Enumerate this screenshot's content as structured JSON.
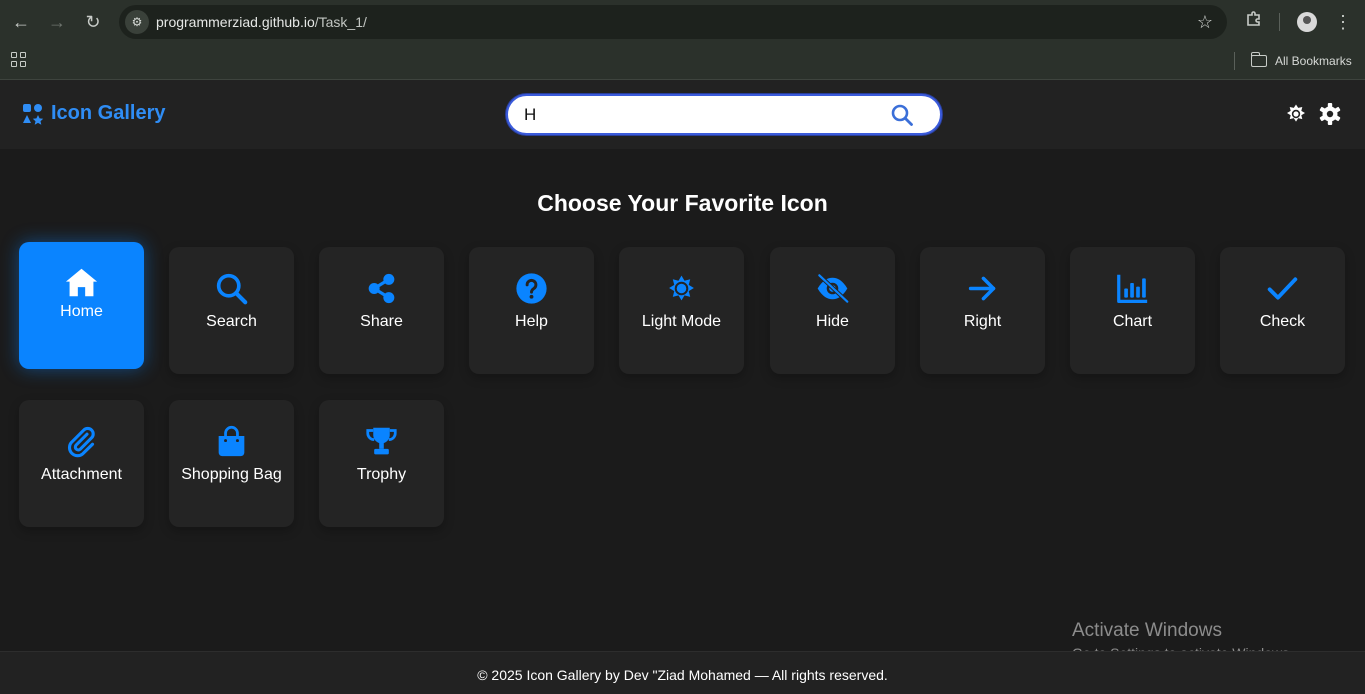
{
  "browser": {
    "url_host": "programmerziad.github.io",
    "url_path": "/Task_1/",
    "all_bookmarks_label": "All Bookmarks"
  },
  "header": {
    "logo_text": "Icon Gallery",
    "search_value": "H",
    "accent_color": "#0a84ff"
  },
  "main": {
    "title": "Choose Your Favorite Icon",
    "cards": [
      {
        "label": "Home",
        "icon": "home-icon",
        "active": true
      },
      {
        "label": "Search",
        "icon": "search-icon",
        "active": false
      },
      {
        "label": "Share",
        "icon": "share-icon",
        "active": false
      },
      {
        "label": "Help",
        "icon": "help-icon",
        "active": false
      },
      {
        "label": "Light Mode",
        "icon": "light-mode-icon",
        "active": false
      },
      {
        "label": "Hide",
        "icon": "hide-icon",
        "active": false
      },
      {
        "label": "Right",
        "icon": "arrow-right-icon",
        "active": false
      },
      {
        "label": "Chart",
        "icon": "chart-icon",
        "active": false
      },
      {
        "label": "Check",
        "icon": "check-icon",
        "active": false
      },
      {
        "label": "Attachment",
        "icon": "attachment-icon",
        "active": false
      },
      {
        "label": "Shopping Bag",
        "icon": "shopping-bag-icon",
        "active": false
      },
      {
        "label": "Trophy",
        "icon": "trophy-icon",
        "active": false
      }
    ]
  },
  "footer": {
    "text": "© 2025 Icon Gallery by Dev \"Ziad Mohamed — All rights reserved."
  },
  "watermark": {
    "line1": "Activate Windows",
    "line2": "Go to Settings to activate Windows."
  }
}
